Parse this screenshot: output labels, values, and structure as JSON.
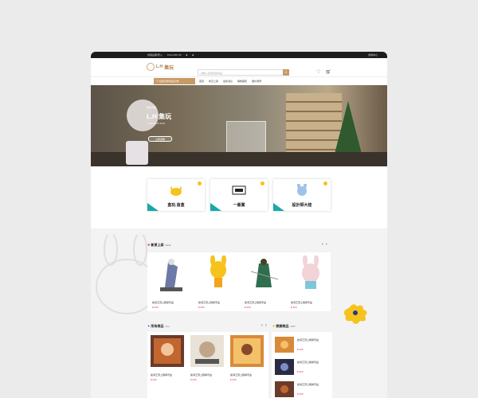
{
  "topbar": {
    "left_text": "會員註冊/登入",
    "mid_text": "FOLLOW US",
    "right_text": "會員中心"
  },
  "header": {
    "logo_mark": "L.H",
    "logo_name": "集玩",
    "search_placeholder": "請輸入您想找的商品",
    "search_icon": "search-icon",
    "wishlist_icon": "heart-icon",
    "cart_icon": "cart-icon",
    "cart_count": "0"
  },
  "nav": {
    "category_label": "☰ 全部分類/商品分類",
    "items": [
      "首頁",
      "新貨上架",
      "最新消息",
      "購物需知",
      "關於我們"
    ]
  },
  "hero": {
    "small": "歡迎光臨",
    "title": "L.H 集玩",
    "sub": "COLLECT FUN",
    "button": "立即選購"
  },
  "categories": [
    {
      "label": "盒玩.盲盒"
    },
    {
      "label": "一番賞"
    },
    {
      "label": "設計師大娃"
    }
  ],
  "new_arrivals": {
    "title": "新貨上架",
    "title_en": "NEW",
    "arrows": "‹ ›",
    "products": [
      {
        "name": "航海王頂上戰爭景盒",
        "price": "$ 200"
      },
      {
        "name": "航海王頂上戰爭景盒",
        "price": "$ 200"
      },
      {
        "name": "航海王頂上戰爭景盒",
        "price": "$ 200"
      },
      {
        "name": "航海王頂上戰爭景盒",
        "price": "$ 200"
      }
    ]
  },
  "all_products": {
    "title": "所有商品",
    "title_en": "ALL",
    "arrows": "‹ ›",
    "products": [
      {
        "name": "航海王頂上戰爭景盒",
        "price": "$ 200"
      },
      {
        "name": "航海王頂上戰爭景盒",
        "price": "$ 200"
      },
      {
        "name": "航海王頂上戰爭景盒",
        "price": "$ 200"
      }
    ]
  },
  "hot_products": {
    "title": "熱銷商品",
    "title_en": "HOT",
    "products": [
      {
        "name": "航海王頂上戰爭景盒",
        "price": "$ 200"
      },
      {
        "name": "航海王頂上戰爭景盒",
        "price": "$ 200"
      },
      {
        "name": "航海王頂上戰爭景盒",
        "price": "$ 200"
      }
    ]
  },
  "colors": {
    "accent": "#c79a66",
    "price": "#dd3333",
    "teal": "#1aa8a8",
    "yellow": "#f6c21c",
    "navy": "#1f3a8a"
  }
}
